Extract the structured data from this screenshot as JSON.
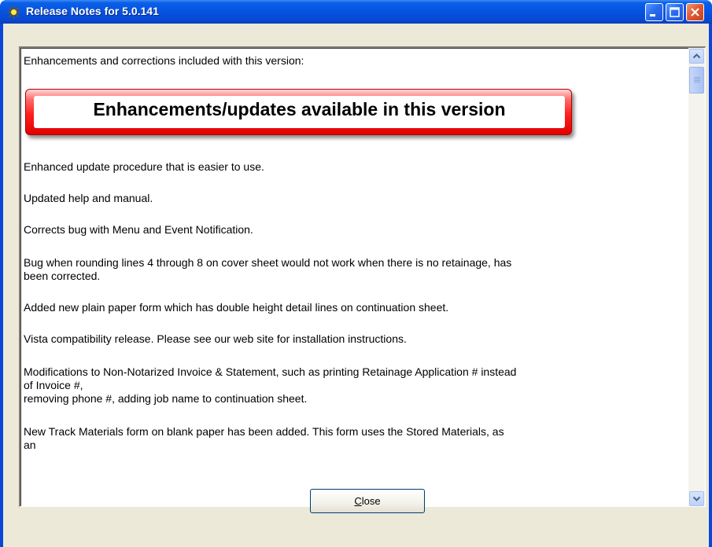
{
  "window": {
    "title": "Release Notes for 5.0.141"
  },
  "notes": {
    "intro": "Enhancements and corrections included with this version:",
    "banner": "Enhancements/updates available in this version",
    "items": [
      "Enhanced update procedure that is easier to use.",
      "Updated help and manual.",
      "Corrects bug with Menu and Event Notification.",
      "Bug when rounding lines 4 through 8 on cover sheet would not work when there is no retainage, has",
      "been corrected.",
      "Added new plain paper form which has double height detail lines on continuation sheet.",
      "Vista compatibility release.  Please see our web site for installation instructions.",
      "Modifications to Non-Notarized Invoice & Statement, such as printing Retainage Application # instead",
      "of Invoice #,",
      "removing phone #, adding job name to continuation sheet.",
      "New Track Materials form on blank paper has been added.  This form uses the Stored Materials, as",
      "an"
    ]
  },
  "footer": {
    "close_label_prefix": "",
    "close_label_accel": "C",
    "close_label_rest": "lose"
  }
}
